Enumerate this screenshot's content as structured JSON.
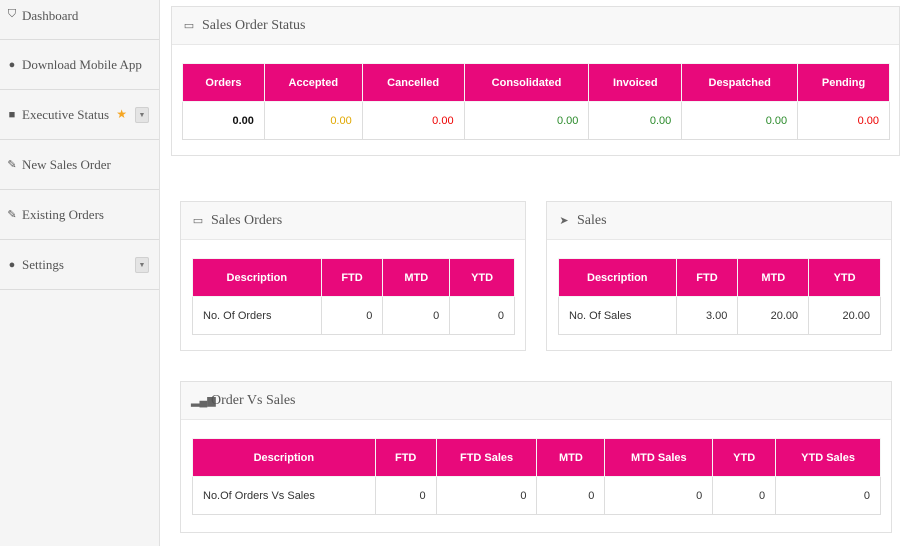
{
  "sidebar": {
    "items": [
      {
        "label": "Dashboard",
        "icon": "shield-icon"
      },
      {
        "label": "Download Mobile App",
        "icon": "globe-icon"
      },
      {
        "label": "Executive Status",
        "icon": "briefcase-icon"
      },
      {
        "label": "New Sales Order",
        "icon": "edit-icon"
      },
      {
        "label": "Existing Orders",
        "icon": "edit-icon"
      },
      {
        "label": "Settings",
        "icon": "globe-icon"
      }
    ],
    "star_glyph": "★",
    "caret_glyph": "▼"
  },
  "sales_order_status": {
    "title": "Sales Order Status",
    "headers": [
      "Orders",
      "Accepted",
      "Cancelled",
      "Consolidated",
      "Invoiced",
      "Despatched",
      "Pending"
    ],
    "values": [
      "0.00",
      "0.00",
      "0.00",
      "0.00",
      "0.00",
      "0.00",
      "0.00"
    ],
    "colors": {
      "orders": "#111111",
      "accepted": "#e0a800",
      "cancelled": "#ee0000",
      "consolidated": "#2a8a2a",
      "invoiced": "#2a8a2a",
      "despatched": "#2a8a2a",
      "pending": "#ee0000"
    }
  },
  "sales_orders": {
    "title": "Sales Orders",
    "headers": [
      "Description",
      "FTD",
      "MTD",
      "YTD"
    ],
    "row": [
      "No. Of Orders",
      "0",
      "0",
      "0"
    ]
  },
  "sales": {
    "title": "Sales",
    "headers": [
      "Description",
      "FTD",
      "MTD",
      "YTD"
    ],
    "row": [
      "No. Of Sales",
      "3.00",
      "20.00",
      "20.00"
    ]
  },
  "order_vs_sales": {
    "title": "Order Vs Sales",
    "headers": [
      "Description",
      "FTD",
      "FTD Sales",
      "MTD",
      "MTD Sales",
      "YTD",
      "YTD Sales"
    ],
    "row": [
      "No.Of Orders Vs Sales",
      "0",
      "0",
      "0",
      "0",
      "0",
      "0"
    ]
  },
  "theme": {
    "header_pink": "#e8097b"
  }
}
